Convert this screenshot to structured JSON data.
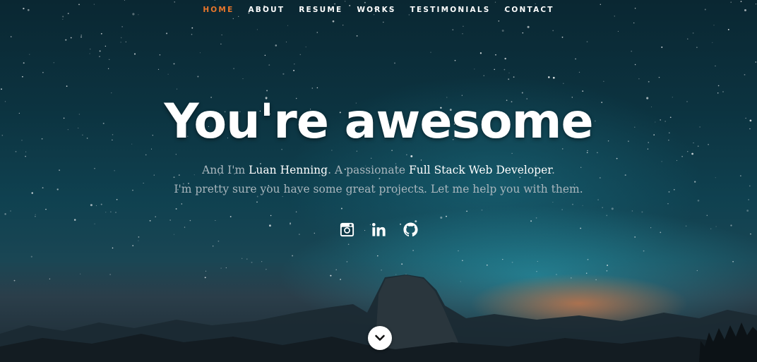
{
  "nav": {
    "items": [
      {
        "label": "HOME",
        "active": true
      },
      {
        "label": "ABOUT",
        "active": false
      },
      {
        "label": "RESUME",
        "active": false
      },
      {
        "label": "WORKS",
        "active": false
      },
      {
        "label": "TESTIMONIALS",
        "active": false
      },
      {
        "label": "CONTACT",
        "active": false
      }
    ],
    "active_color": "#e8762b"
  },
  "hero": {
    "headline": "You're awesome",
    "tagline": {
      "line1_prefix": "And I'm ",
      "name": "Luan Henning",
      "line1_mid": ". A passionate ",
      "role": "Full Stack Web Developer",
      "line1_suffix": ".",
      "line2": "I'm pretty sure you have some great projects. Let me help you with them."
    }
  },
  "social": {
    "icons": [
      "instagram-icon",
      "linkedin-icon",
      "github-icon"
    ]
  },
  "scroll_button": {
    "icon": "chevron-down-icon"
  },
  "colors": {
    "accent": "#e8762b",
    "text_muted": "#a9b6bd",
    "text_primary": "#ffffff"
  }
}
